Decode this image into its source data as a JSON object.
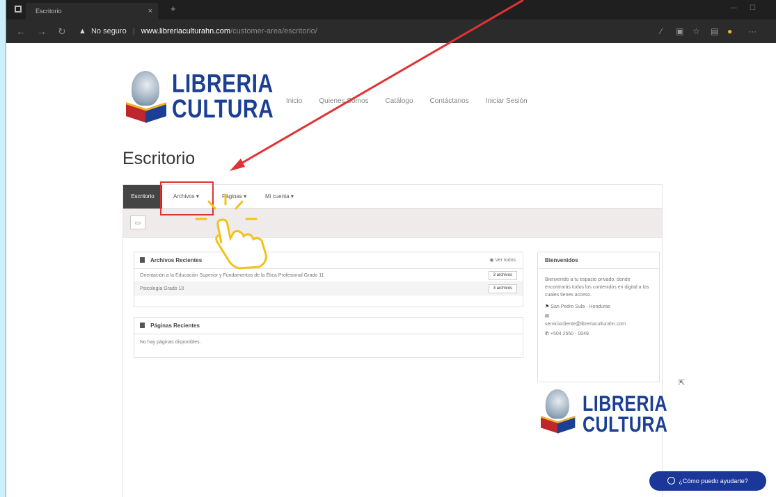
{
  "browser": {
    "tab_title": "Escritorio",
    "tab_close": "×",
    "new_tab": "+",
    "security_label": "No seguro",
    "url_host": "www.libreriaculturahn.com",
    "url_path": "/customer-area/escritorio/"
  },
  "site": {
    "logo_line1": "LIBRERIA",
    "logo_line2": "CULTURA",
    "nav": [
      "Inicio",
      "Quienes Somos",
      "Catálogo",
      "Contáctanos",
      "Iniciar Sesión"
    ]
  },
  "page": {
    "title": "Escritorio"
  },
  "dashboard_nav": {
    "active": "Escritorio",
    "items": [
      "Archivos ▾",
      "Páginas ▾",
      "Mi cuenta ▾"
    ]
  },
  "toolbar": {
    "button_icon": "folder-icon"
  },
  "recent_files": {
    "title": "Archivos Recientes",
    "view_all": "Ver todos",
    "rows": [
      {
        "name": "Orientación a la Educación Superior y Fundamentos de la Ética Profesional Grado 11",
        "count": "3 archivos"
      },
      {
        "name": "Psicología Grado 10",
        "count": "3 archivos"
      }
    ]
  },
  "recent_pages": {
    "title": "Páginas Recientes",
    "empty": "No hay páginas disponibles."
  },
  "welcome": {
    "title": "Bienvenidos",
    "body": "Bienvenido a tu espacio privado, donde encontrarás todos los contenidos en digital a los cuales tienes acceso.",
    "location": "San Pedro Sula - Honduras",
    "email": "serviciocliente@libreriaculturahn.com",
    "phone": "+504 2550 - 0049"
  },
  "chat": {
    "label": "¿Cómo puedo ayudarte?"
  },
  "colors": {
    "brand_blue": "#1b3f95",
    "brand_red": "#c0262d",
    "annotation_red": "#e03333",
    "annotation_yellow": "#f2c21b",
    "chat_blue": "#1a3799"
  }
}
